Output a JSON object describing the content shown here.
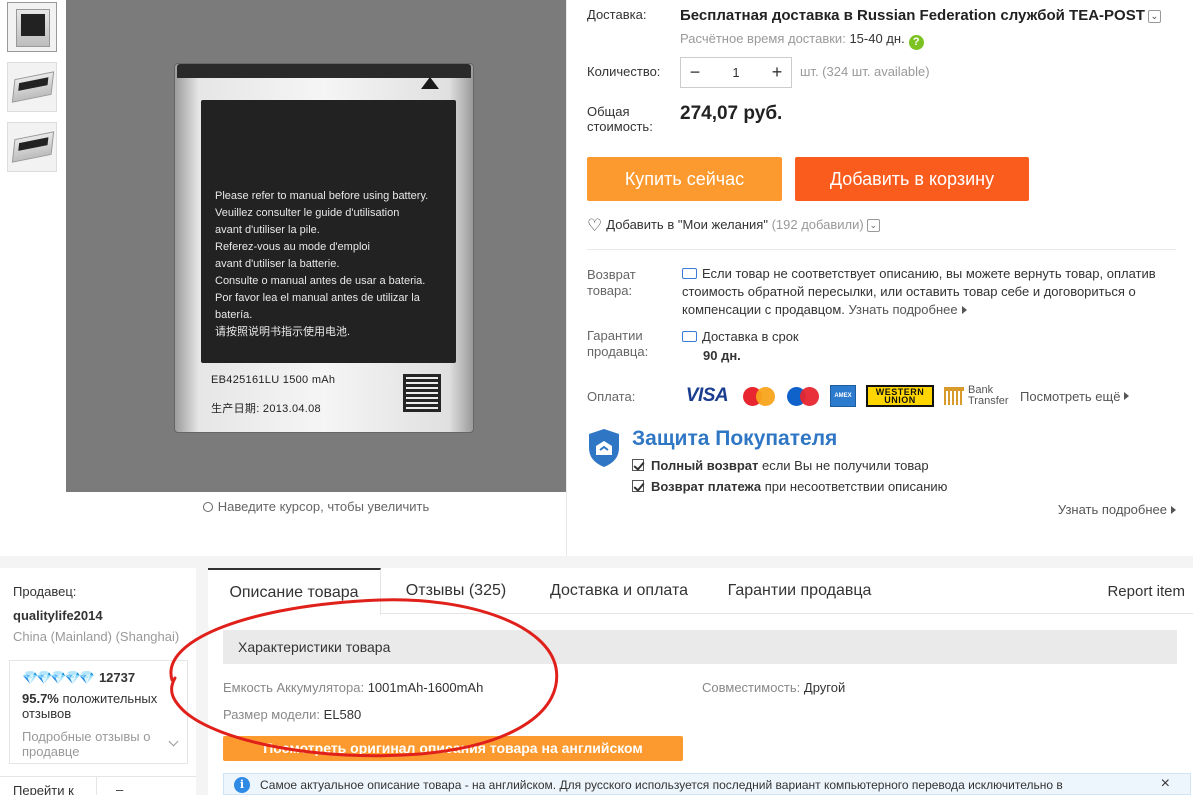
{
  "gallery": {
    "zoom_hint": "Наведите курсор, чтобы увеличить",
    "battery_text": [
      "Please refer to manual before using battery.",
      "Veuillez consulter le guide d'utilisation",
      "avant d'utiliser la pile.",
      "Referez-vous au mode d'emploi",
      "avant d'utiliser la batterie.",
      "Consulte o manual antes de usar a bateria.",
      "Por favor lea el manual antes de utilizar la batería.",
      "请按照说明书指示使用电池."
    ],
    "battery_model": "EB425161LU    1500 mAh",
    "battery_date": "生产日期:    2013.04.08"
  },
  "shipping": {
    "label": "Доставка:",
    "title": "Бесплатная доставка в Russian Federation службой TEA-POST",
    "time_label": "Расчётное время доставки:",
    "time_value": "15-40 дн.",
    "help_icon": "?"
  },
  "quantity": {
    "label": "Количество:",
    "minus": "−",
    "value": "1",
    "plus": "+",
    "available": "шт. (324 шт. available)"
  },
  "total": {
    "label_1": "Общая",
    "label_2": "стоимость:",
    "value": "274,07 руб."
  },
  "actions": {
    "buy_now": "Купить сейчас",
    "add_to_cart": "Добавить в корзину",
    "colors": {
      "buy": "#fd9a2f",
      "cart": "#fa5c1e"
    }
  },
  "wishlist": {
    "label": "Добавить в \"Мои желания\"",
    "count": "(192 добавили)"
  },
  "returns": {
    "label_1": "Возврат",
    "label_2": "товара:",
    "text": "Если товар не соответствует описанию, вы можете вернуть товар, оплатив стоимость обратной пересылки, или оставить товар себе и договориться о компенсации с продавцом.",
    "more": "Узнать подробнее"
  },
  "guarantee": {
    "label_1": "Гарантии",
    "label_2": "продавца:",
    "line1": "Доставка в срок",
    "line2": "90 дн."
  },
  "payment": {
    "label": "Оплата:",
    "visa": "VISA",
    "mastercard": "MasterCard",
    "maestro": "Maestro",
    "amex": "AMEX",
    "wu_1": "WESTERN",
    "wu_2": "UNION",
    "bank_1": "Bank",
    "bank_2": "Transfer",
    "see_more": "Посмотреть ещё"
  },
  "protection": {
    "title": "Защита Покупателя",
    "item1_bold": "Полный возврат",
    "item1_rest": " если Вы не получили товар",
    "item2_bold": "Возврат платежа",
    "item2_rest": " при несоответствии описанию",
    "learn_more": "Узнать подробнее",
    "color": "#2f77c4"
  },
  "seller": {
    "label": "Продавец:",
    "name": "qualitylife2014",
    "location": "China (Mainland) (Shanghai)",
    "diamonds": "💎💎💎💎💎",
    "score": "12737",
    "positive_pct": "95.7%",
    "positive_text": " положительных отзывов",
    "detailed_reviews": "Подробные отзывы о продавце",
    "goto": "Перейти к",
    "goto_right": "–"
  },
  "tabs": {
    "description": "Описание товара",
    "reviews": "Отзывы (325)",
    "delivery": "Доставка и оплата",
    "guarantees": "Гарантии продавца",
    "report": "Report item"
  },
  "specs": {
    "header": "Характеристики товара",
    "battery_capacity_k": "Емкость Аккумулятора:",
    "battery_capacity_v": " 1001mAh-1600mAh",
    "compat_k": "Совместимость:",
    "compat_v": " Другой",
    "model_k": "Размер модели:",
    "model_v": " EL580",
    "original_button": "Посмотреть оригинал описания товара на английском",
    "notice": "Самое актуальное описание товара - на английском. Для русского используется последний вариант компьютерного перевода исключительно в",
    "notice_icon": "i",
    "close": "×"
  },
  "annotation": {
    "color": "#e0201b",
    "shape": "hand-drawn-ellipse"
  }
}
